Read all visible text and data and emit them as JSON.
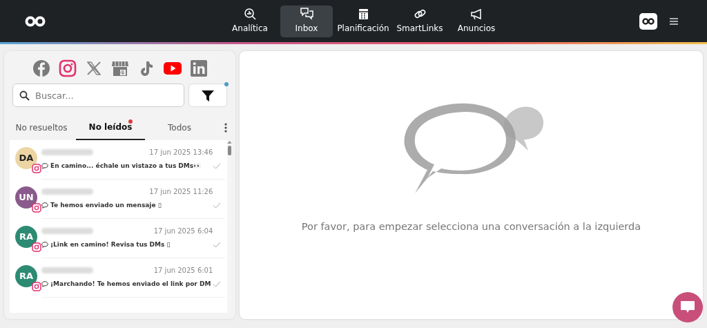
{
  "navbar": {
    "items": [
      {
        "label": "Analítica",
        "kind": "analytics",
        "selected": false
      },
      {
        "label": "Inbox",
        "kind": "inbox",
        "selected": true
      },
      {
        "label": "Planificación",
        "kind": "calendar",
        "selected": false
      },
      {
        "label": "SmartLinks",
        "kind": "links",
        "selected": false
      },
      {
        "label": "Anuncios",
        "kind": "megaphone",
        "selected": false
      }
    ]
  },
  "networks": [
    {
      "kind": "facebook",
      "selected": false
    },
    {
      "kind": "instagram",
      "selected": true
    },
    {
      "kind": "x",
      "selected": false
    },
    {
      "kind": "business",
      "selected": false
    },
    {
      "kind": "tiktok",
      "selected": false
    },
    {
      "kind": "youtube",
      "selected": true
    },
    {
      "kind": "linkedin",
      "selected": false
    }
  ],
  "search": {
    "placeholder": "Buscar..."
  },
  "filter": {
    "active": true
  },
  "tabs": [
    {
      "label": "No resueltos",
      "selected": false,
      "dot": false
    },
    {
      "label": "No leídos",
      "selected": true,
      "dot": true
    },
    {
      "label": "Todos",
      "selected": false,
      "dot": false
    }
  ],
  "conversations": [
    {
      "initials": "DA",
      "color": "#ecd5a3",
      "time": "17 jun 2025 13:46",
      "message": "En camino... échale un vistazo a tus DMs👀",
      "read": true
    },
    {
      "initials": "UN",
      "color": "#8a5a8c",
      "time": "17 jun 2025 11:26",
      "message": "Te hemos enviado un mensaje ▯",
      "read": true
    },
    {
      "initials": "RA",
      "color": "#2e8b73",
      "time": "17 jun 2025 6:04",
      "message": "¡Link en camino! Revisa tus DMs ▯",
      "read": true
    },
    {
      "initials": "RA",
      "color": "#2e8b73",
      "time": "17 jun 2025 6:01",
      "message": "¡Marchando! Te hemos enviado el link por DM",
      "read": true
    }
  ],
  "empty_state": {
    "message": "Por favor, para empezar selecciona una conversación a la izquierda"
  }
}
